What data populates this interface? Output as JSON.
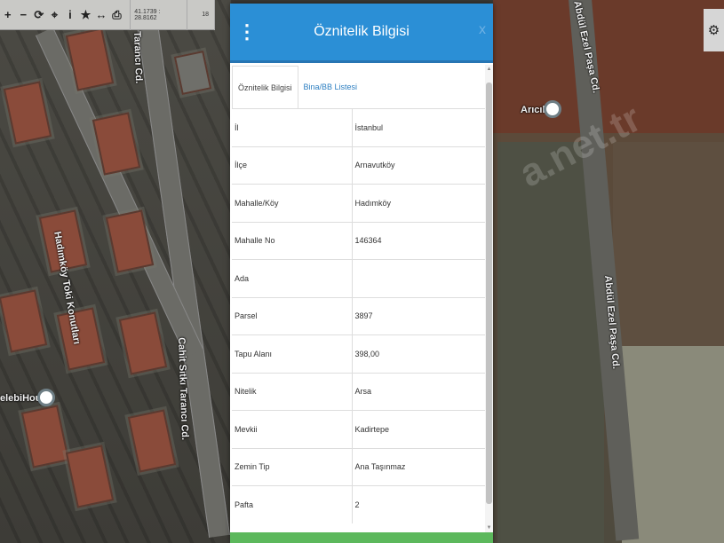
{
  "toolbar": {
    "buttons": [
      "+",
      "−",
      "⟳",
      "⌖",
      "i",
      "★",
      "↔",
      "⎙"
    ],
    "coords": "41.1739 : 28.8162",
    "zoom": "18"
  },
  "map": {
    "labels": [
      "Hadımköy Toki Konutları",
      "Tarancı Cd.",
      "Cahit Sıtkı Tarancı Cd.",
      "Abdül Ezel Paşa Cd.",
      "Abdül Ezel Paşa Cd.",
      "Arıcık",
      "elebiHouse"
    ],
    "watermark": "a.net.tr"
  },
  "dialog": {
    "title": "Öznitelik Bilgisi",
    "close": "x",
    "tabs": [
      "Öznitelik Bilgisi",
      "Bina/BB Listesi"
    ],
    "rows": [
      {
        "key": "İl",
        "value": "İstanbul"
      },
      {
        "key": "İlçe",
        "value": "Arnavutköy"
      },
      {
        "key": "Mahalle/Köy",
        "value": "Hadımköy"
      },
      {
        "key": "Mahalle No",
        "value": "146364"
      },
      {
        "key": "Ada",
        "value": ""
      },
      {
        "key": "Parsel",
        "value": "3897"
      },
      {
        "key": "Tapu Alanı",
        "value": "398,00"
      },
      {
        "key": "Nitelik",
        "value": "Arsa"
      },
      {
        "key": "Mevkii",
        "value": "Kadirtepe"
      },
      {
        "key": "Zemin Tip",
        "value": "Ana Taşınmaz"
      },
      {
        "key": "Pafta",
        "value": "2"
      }
    ]
  },
  "colors": {
    "header": "#2b8fd6",
    "link": "#2d7fc1",
    "footer": "#5cb85c"
  }
}
